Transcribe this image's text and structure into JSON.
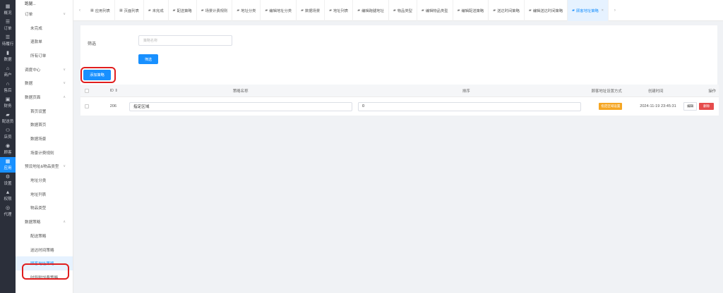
{
  "rail": [
    {
      "icon": "grid-icon",
      "glyph": "▦",
      "label": "概况"
    },
    {
      "icon": "list-icon",
      "glyph": "☰",
      "label": "订单"
    },
    {
      "icon": "list-icon",
      "glyph": "☰",
      "label": "待履行"
    },
    {
      "icon": "chart-icon",
      "glyph": "▮",
      "label": "数据"
    },
    {
      "icon": "store-icon",
      "glyph": "⌂",
      "label": "商户"
    },
    {
      "icon": "headset-icon",
      "glyph": "∩",
      "label": "售后"
    },
    {
      "icon": "wallet-icon",
      "glyph": "▣",
      "label": "财务"
    },
    {
      "icon": "truck-icon",
      "glyph": "▰",
      "label": "配送员"
    },
    {
      "icon": "user-icon",
      "glyph": "⚇",
      "label": "店员"
    },
    {
      "icon": "customer-icon",
      "glyph": "◉",
      "label": "顾客"
    },
    {
      "icon": "apps-icon",
      "glyph": "▦",
      "label": "应用"
    },
    {
      "icon": "settings-icon",
      "glyph": "⚙",
      "label": "设置"
    },
    {
      "icon": "lock-icon",
      "glyph": "▲",
      "label": "权限"
    },
    {
      "icon": "agent-icon",
      "glyph": "◎",
      "label": "代理"
    }
  ],
  "submenu": {
    "top_label": "跑腿...",
    "items": [
      {
        "label": "订单",
        "type": "group",
        "chev": "∨"
      },
      {
        "label": "未完成",
        "type": "child"
      },
      {
        "label": "退款单",
        "type": "child"
      },
      {
        "label": "所有订单",
        "type": "child"
      },
      {
        "label": "调度中心",
        "type": "group",
        "chev": "∨"
      },
      {
        "label": "数据",
        "type": "group",
        "chev": "∨"
      },
      {
        "label": "数据页面",
        "type": "group",
        "chev": "∧"
      },
      {
        "label": "首页设置",
        "type": "child"
      },
      {
        "label": "数据首页",
        "type": "child"
      },
      {
        "label": "数据场景",
        "type": "child"
      },
      {
        "label": "场景计费规则",
        "type": "child"
      },
      {
        "label": "预设地址&物品类型",
        "type": "group",
        "chev": "∨"
      },
      {
        "label": "地址分类",
        "type": "child"
      },
      {
        "label": "地址列表",
        "type": "child"
      },
      {
        "label": "物品类型",
        "type": "child"
      },
      {
        "label": "数据策略",
        "type": "group",
        "chev": "∧"
      },
      {
        "label": "配送策略",
        "type": "child"
      },
      {
        "label": "送达时间策略",
        "type": "child"
      },
      {
        "label": "顾客地址策略",
        "type": "child",
        "active": true
      },
      {
        "label": "时段附加费策略",
        "type": "child"
      }
    ]
  },
  "tabs": [
    {
      "label": "应用列表",
      "icon": "apps-icon"
    },
    {
      "label": "页面列表",
      "icon": "apps-icon"
    },
    {
      "label": "未完成",
      "icon": "truck-icon"
    },
    {
      "label": "配送策略",
      "icon": "truck-icon"
    },
    {
      "label": "场景计费规则",
      "icon": "truck-icon"
    },
    {
      "label": "地址分类",
      "icon": "truck-icon"
    },
    {
      "label": "编辑地址分类",
      "icon": "truck-icon"
    },
    {
      "label": "数据场景",
      "icon": "truck-icon"
    },
    {
      "label": "地址列表",
      "icon": "truck-icon"
    },
    {
      "label": "编辑跑腿地址",
      "icon": "truck-icon"
    },
    {
      "label": "物品类型",
      "icon": "truck-icon"
    },
    {
      "label": "编辑物品类型",
      "icon": "truck-icon"
    },
    {
      "label": "编辑配送策略",
      "icon": "truck-icon"
    },
    {
      "label": "送达时间策略",
      "icon": "truck-icon"
    },
    {
      "label": "编辑送达时间策略",
      "icon": "truck-icon"
    },
    {
      "label": "顾客地址策略",
      "icon": "truck-icon",
      "active": true
    }
  ],
  "filter": {
    "label": "筛选",
    "placeholder": "策略名称",
    "button": "筛选"
  },
  "add_button": "添加策略",
  "table": {
    "headers": {
      "id": "ID ⇕",
      "name": "策略名称",
      "order": "排序",
      "mode": "顾客地址设置方式",
      "time": "创建时间",
      "ops": "操作"
    },
    "rows": [
      {
        "id": "206",
        "name": "指定区域",
        "order": "0",
        "mode": "指定区域设置",
        "time": "2024-11-19 23:45:31",
        "edit": "编辑",
        "delete": "删除"
      }
    ]
  },
  "colors": {
    "accent": "#1890ff",
    "rail": "#2b2f3a",
    "badge": "#f5a623",
    "danger": "#e64c4c",
    "highlight": "#e01e1e"
  }
}
